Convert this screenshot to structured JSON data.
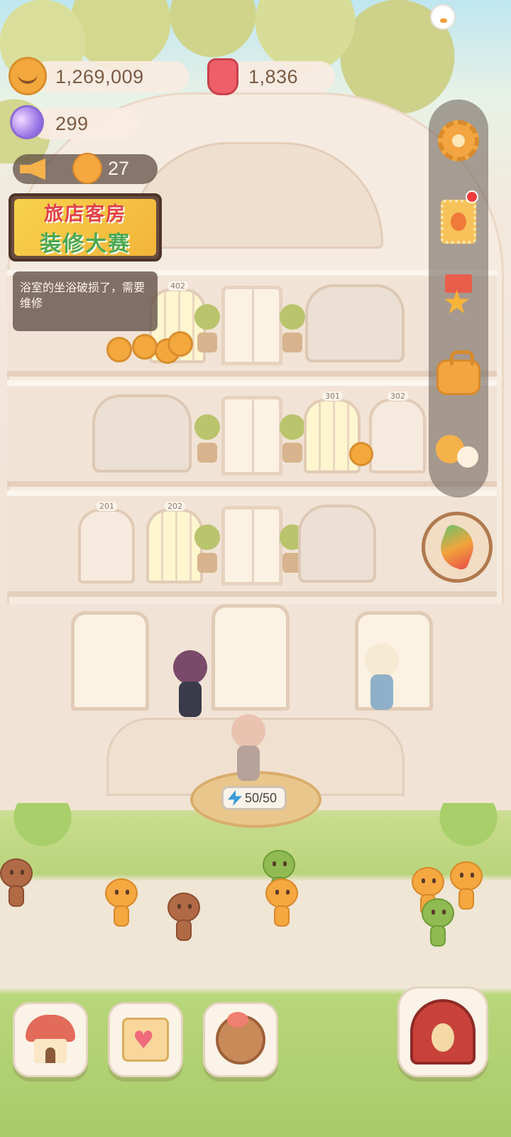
{
  "resources": {
    "coins": "1,269,009",
    "jelly": "1,836",
    "crystals": "299"
  },
  "announcement": {
    "count": "27"
  },
  "event_banner": {
    "line1": "旅店客房",
    "line2": "装修大赛"
  },
  "tip": {
    "text": "浴室的坐浴破损了，需要维修"
  },
  "rooms": {
    "r402": "402",
    "r301": "301",
    "r302": "302",
    "r201": "201",
    "r202": "202"
  },
  "stamina": {
    "value": "50/50"
  },
  "side_menu": {
    "icons": [
      "gear-icon",
      "cookie-card-icon",
      "medal-icon",
      "bag-icon",
      "friends-icon"
    ],
    "has_notification": true
  },
  "bottom_bar": {
    "icons": [
      "mushroom-house-icon",
      "notebook-icon",
      "cookie-portrait-icon",
      "circus-tent-icon"
    ]
  },
  "colors": {
    "coin": "#f3a83e",
    "jelly": "#ee5f6a",
    "crystal": "#9e7be8",
    "notification": "#ef3b3b"
  }
}
